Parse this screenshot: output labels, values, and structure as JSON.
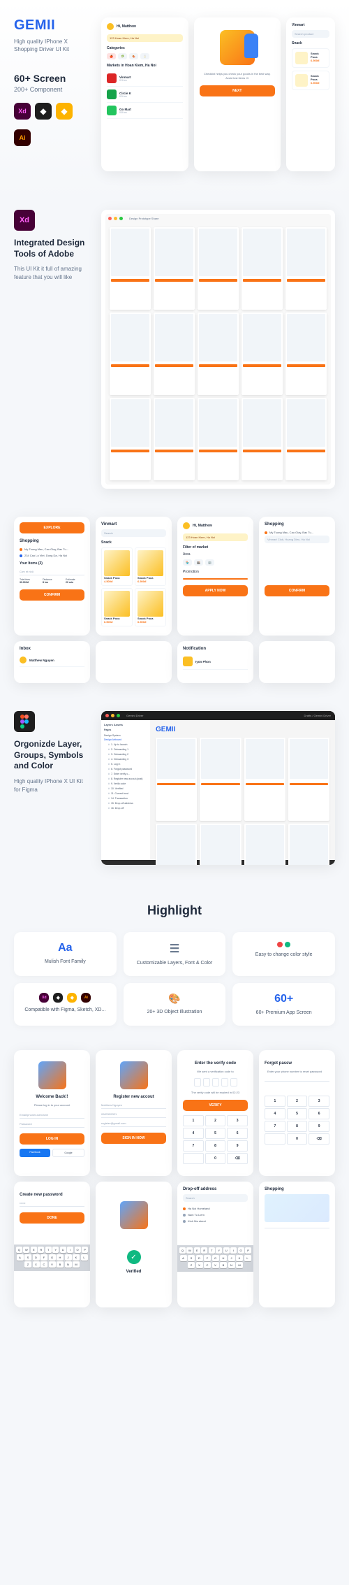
{
  "brand": {
    "logo": "GEMII",
    "tagline": "High quality IPhone X Shopping Driver UI Kit"
  },
  "stats": {
    "screens": "60+ Screen",
    "components": "200+ Component"
  },
  "tools": {
    "xd": "Xd",
    "figma": "◆",
    "sketch": "◆",
    "ai": "Ai"
  },
  "phone1": {
    "greeting": "Hi, Matthew",
    "address": "123 Hoan Kiem, Ha Noi",
    "categories_label": "Categories",
    "markets_label": "Markets in Hoan Kiem, Ha Noi",
    "items": [
      {
        "name": "Vinmart",
        "sub": "0.3 km"
      },
      {
        "name": "Circle K",
        "sub": "0.5 km"
      },
      {
        "name": "Go Mart",
        "sub": "0.8 km"
      }
    ]
  },
  "phone2": {
    "desc": "Checklist helps you check your goods in the best way. Avoid lost items :D",
    "btn": "NEXT"
  },
  "phone3": {
    "title": "Vinmart",
    "search": "Search product",
    "label": "Snack",
    "prod_name": "Snack Poca",
    "prod_price": "6.500đ"
  },
  "section2": {
    "title": "Integrated Design Tools of Adobe",
    "desc": "This UI Kit it full of amazing feature that you will like",
    "tabs": "Design  Prototype  Share"
  },
  "sec3": {
    "explore": "EXPLORE",
    "shopping": "Shopping",
    "addr1": "My Tuong Mau, Cau Giay, Bac Tu...",
    "addr2": "234 Cao Lo Viet, Dong Da, Ha Noi",
    "items_label": "Your Items (3)",
    "item1": "Cơn et nhỏ",
    "total": "Total fees",
    "total_val": "39.000đ",
    "distance": "Distance",
    "distance_val": "8 km",
    "time": "Estimate",
    "time_val": "20 min",
    "confirm": "CONFIRM",
    "vinmart": "Vinmart",
    "search": "Search",
    "snack": "Snack",
    "snack_poca": "Snack Poca",
    "price1": "4.500đ",
    "price2": "6.500đ",
    "filter": "Filter of market",
    "area": "Area",
    "promo": "Promotion",
    "apply": "APPLY NOW",
    "inbox": "Inbox",
    "user": "Matthew Nguyen",
    "notif": "Notification",
    "notif_item": "Iyon Phon"
  },
  "section4": {
    "title": "Orgonizde Layer, Groups, Symbols and Color",
    "desc": "High quality IPhone X UI Kit for Figma",
    "window_title": "Gemini Driver",
    "drafts": "Drafts / Gemini Driver",
    "layers": "Layers  Assets",
    "pages": "Pages",
    "design_system": "Design System",
    "artboard": "Design Artboard",
    "layer_list": [
      "1. Up to launch",
      "2. Onboarding 1",
      "3. Onboarding 2",
      "4. Onboarding 3",
      "5. Log in",
      "6. Forgot password",
      "7. Enter verify c...",
      "8. Register new accout (post)",
      "9. Verify code",
      "10. Verified",
      "11. Current trust",
      "14. Transaction",
      "15. Drop-off address",
      "16. Drop-off"
    ]
  },
  "highlight": {
    "title": "Highlight",
    "cards": [
      {
        "icon": "Aa",
        "text": "Mulish Font Family"
      },
      {
        "icon": "▭",
        "text": "Customizable Layers, Font & Color"
      },
      {
        "icon": "dots",
        "text": "Easy to change color style"
      },
      {
        "icon": "tools",
        "text": "Compatible with Figma, Sketch, XD..."
      },
      {
        "icon": "🎨",
        "text": "20+ 3D Object Illustration"
      },
      {
        "icon": "60+",
        "text": "60+ Premium App Screen"
      }
    ]
  },
  "bottom": {
    "welcome": {
      "title": "Welcome Back!!",
      "sub": "Please log in to your account",
      "email": "Email/phone/username",
      "pass": "Password",
      "login": "LOG IN",
      "fb": "Facebook",
      "gg": "Google"
    },
    "register": {
      "title": "Register new accout",
      "name": "Matthew Nguyen",
      "phone": "0987655321",
      "email": "register@gmail.com",
      "btn": "SIGN IN NOW"
    },
    "verify": {
      "title": "Enter the verify code",
      "sub": "We sent a verification code to",
      "sub2": "The verify code will be expired in 02:23",
      "btn": "VERIFY"
    },
    "forgot": {
      "title": "Forgot passw",
      "sub": "Enter your phone number to reset password"
    },
    "newpass": {
      "title": "Create new password",
      "btn": "DONE"
    },
    "verified": {
      "title": "Verified"
    },
    "dropoff": {
      "title": "Drop-off address",
      "loc1": "Ha Noi Homeland",
      "search": "Search"
    },
    "shopping": {
      "title": "Shopping"
    }
  },
  "keypad": [
    "1",
    "2",
    "3",
    "4",
    "5",
    "6",
    "7",
    "8",
    "9",
    "",
    "0",
    "⌫"
  ],
  "keyboard": {
    "r1": [
      "Q",
      "W",
      "E",
      "R",
      "T",
      "Y",
      "U",
      "I",
      "O",
      "P"
    ],
    "r2": [
      "A",
      "S",
      "D",
      "F",
      "G",
      "H",
      "J",
      "K",
      "L"
    ],
    "r3": [
      "Z",
      "X",
      "C",
      "V",
      "B",
      "N",
      "M"
    ]
  },
  "colors": {
    "orange": "#f97316",
    "blue": "#2563eb"
  }
}
